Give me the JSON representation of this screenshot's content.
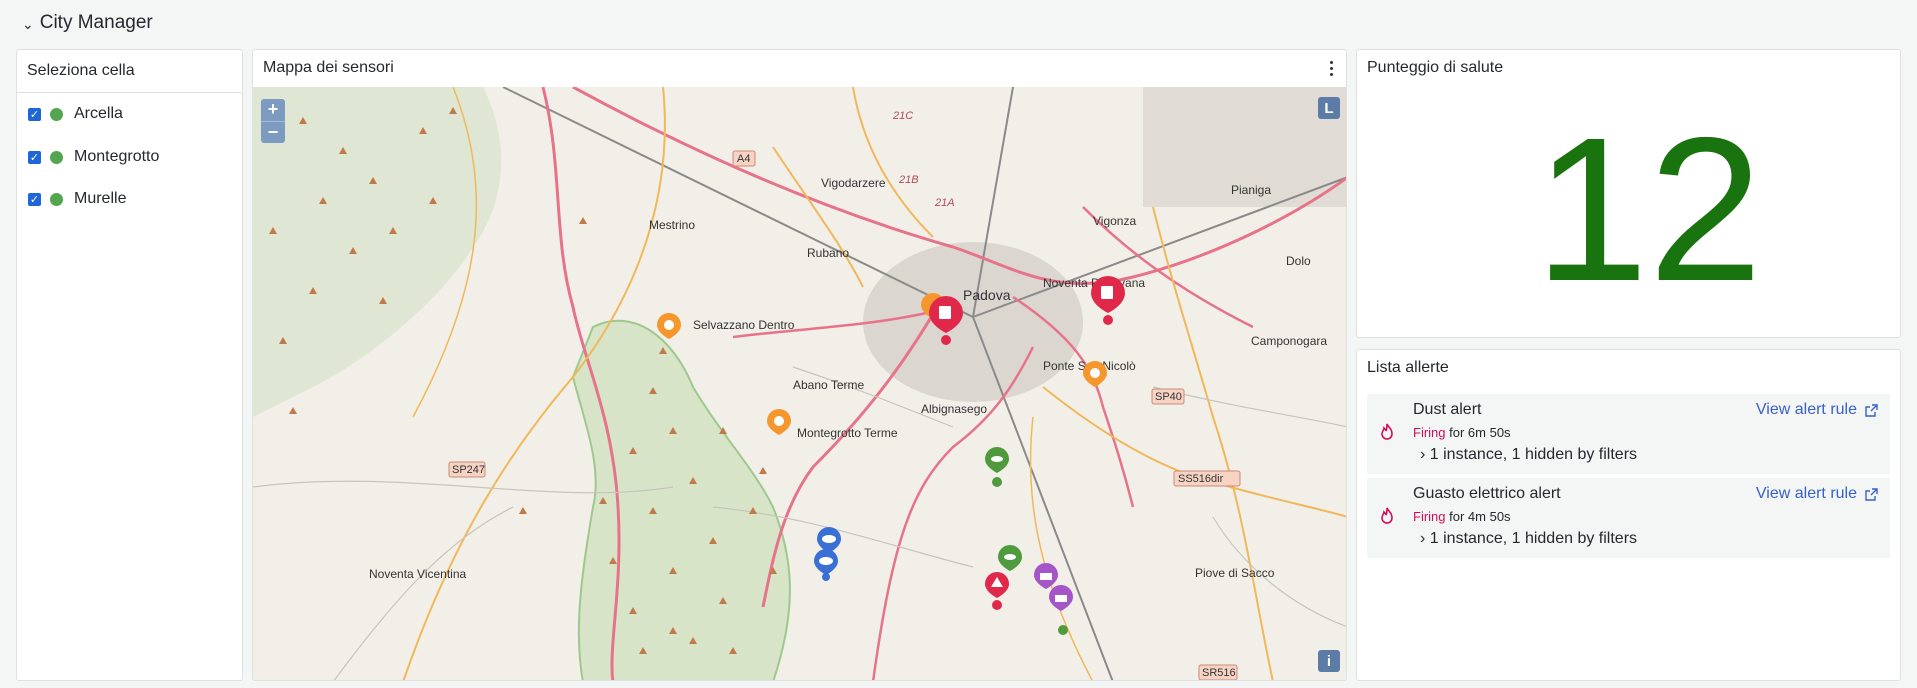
{
  "row": {
    "title": "City Manager"
  },
  "cells": {
    "title": "Seleziona cella",
    "items": [
      {
        "label": "Arcella",
        "checked": true
      },
      {
        "label": "Montegrotto",
        "checked": true
      },
      {
        "label": "Murelle",
        "checked": true
      }
    ]
  },
  "map": {
    "title": "Mappa dei sensori",
    "zoom_in": "+",
    "zoom_out": "−",
    "layer_button": "L",
    "info_button": "i",
    "places": [
      "Vigodarzere",
      "Pianiga",
      "Vigonza",
      "Mestrino",
      "Rubano",
      "Dolo",
      "Padova",
      "Noventa Padovana",
      "Selvazzano Dentro",
      "Camponogara",
      "Ponte San Nicolò",
      "Abano Terme",
      "Albignasego",
      "Montegrotto Terme",
      "Noventa Vicentina",
      "Piove di Sacco"
    ],
    "road_labels": [
      "A4",
      "SP247",
      "SP40",
      "SS516dir",
      "SR516",
      "21C",
      "21B",
      "21A"
    ],
    "marker_colors": {
      "red": "#e0284a",
      "orange": "#f5972d",
      "green": "#4e9a3c",
      "blue": "#3a6fd6",
      "purple": "#a655c8"
    }
  },
  "health": {
    "title": "Punteggio di salute",
    "value": "12",
    "color": "#19730e"
  },
  "alerts": {
    "title": "Lista allerte",
    "items": [
      {
        "name": "Dust alert",
        "state": "Firing",
        "duration": "for 6m 50s",
        "instances": "1 instance, 1 hidden by filters",
        "link": "View alert rule"
      },
      {
        "name": "Guasto elettrico alert",
        "state": "Firing",
        "duration": "for 4m 50s",
        "instances": "1 instance, 1 hidden by filters",
        "link": "View alert rule"
      }
    ]
  }
}
